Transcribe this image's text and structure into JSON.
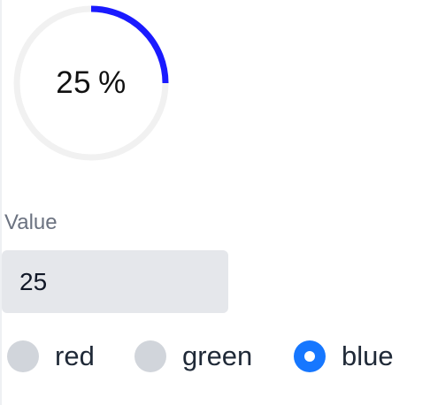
{
  "progress": {
    "value": 25,
    "text": "25",
    "unit": "%",
    "track_color": "#f1f1f1",
    "arc_color": "#1a1aff"
  },
  "value_field": {
    "label": "Value",
    "value": "25"
  },
  "color_options": {
    "selected": "blue",
    "accent_color": "#1677ff",
    "items": [
      {
        "label": "red"
      },
      {
        "label": "green"
      },
      {
        "label": "blue"
      }
    ]
  }
}
